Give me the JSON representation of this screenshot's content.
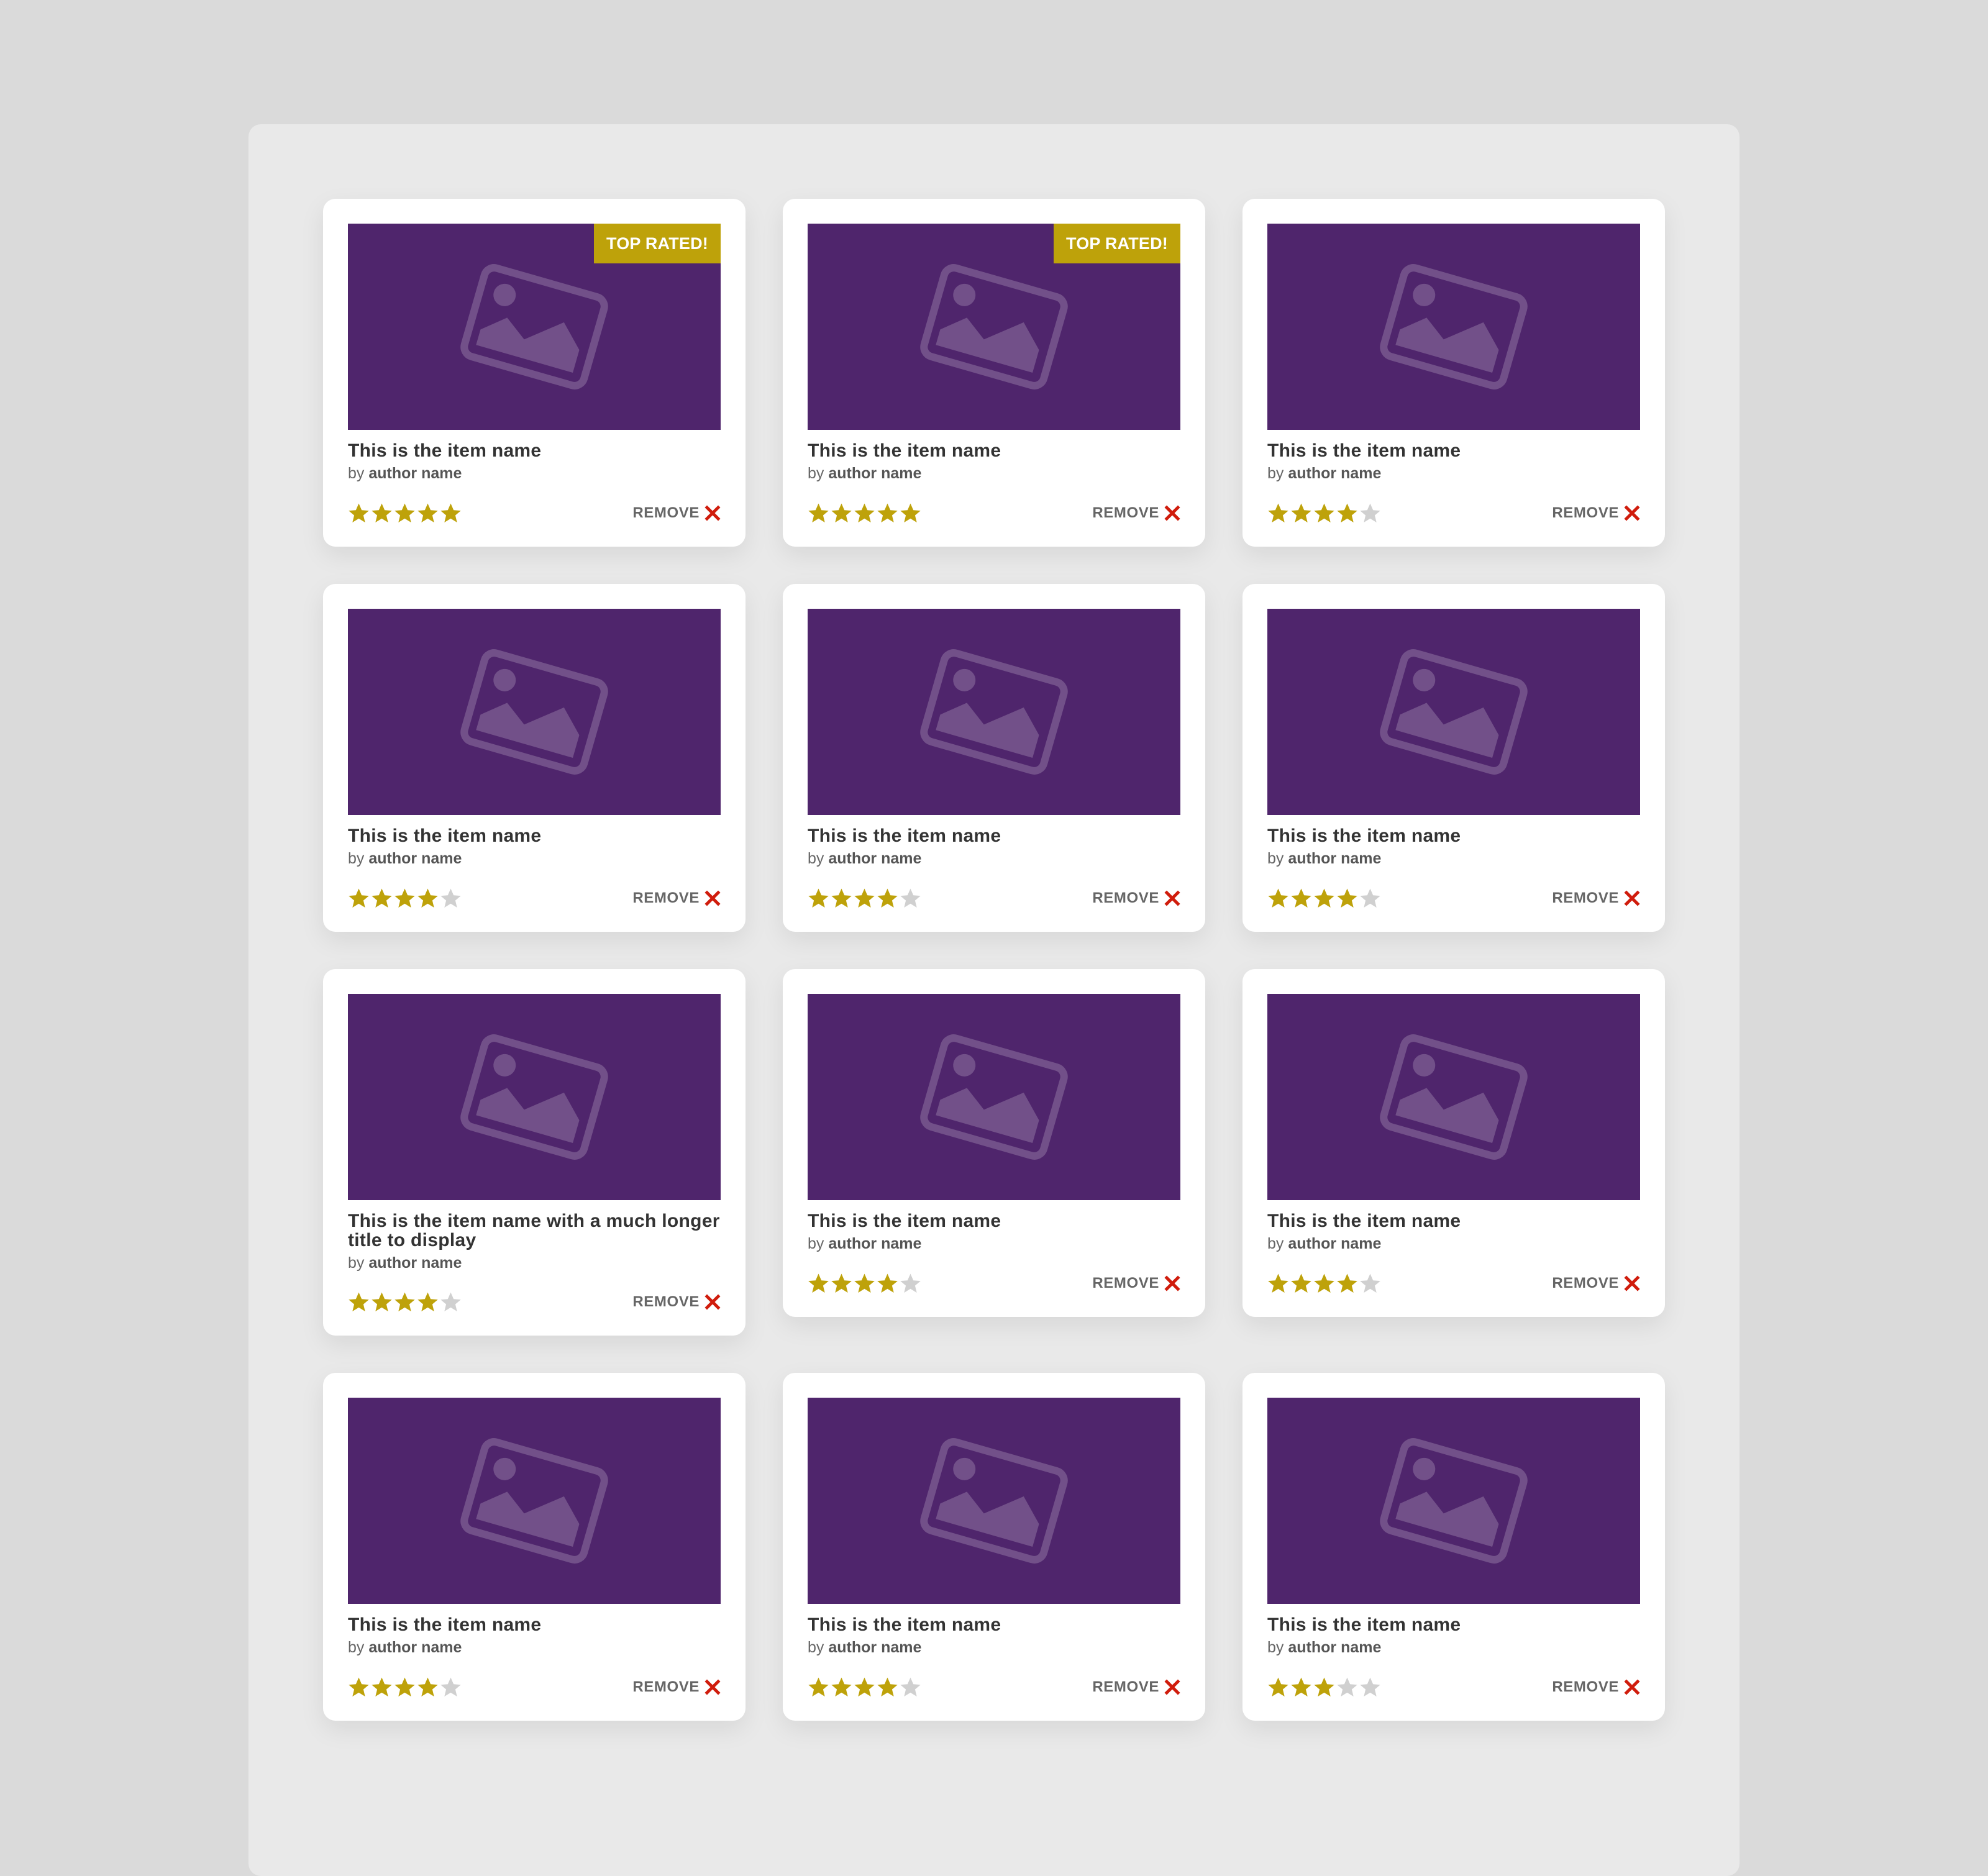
{
  "colors": {
    "page_background": "#dadada",
    "panel_background": "#e9e9e9",
    "image_placeholder": "#4f256c",
    "badge": "#bea20a",
    "star_filled": "#bea20a",
    "star_empty": "#d0d0d0",
    "remove_x": "#d01c0c"
  },
  "labels": {
    "remove": "REMOVE",
    "by": "by"
  },
  "items": [
    {
      "title": "This is the item name",
      "author": "author name",
      "rating": 5,
      "max_rating": 5,
      "badge": "TOP RATED!",
      "icon": "image-placeholder-icon"
    },
    {
      "title": "This is the item name",
      "author": "author name",
      "rating": 5,
      "max_rating": 5,
      "badge": "TOP RATED!",
      "icon": "image-placeholder-icon"
    },
    {
      "title": "This is the item name",
      "author": "author name",
      "rating": 4,
      "max_rating": 5,
      "badge": "",
      "icon": "image-placeholder-icon"
    },
    {
      "title": "This is the item name",
      "author": "author name",
      "rating": 4,
      "max_rating": 5,
      "badge": "",
      "icon": "image-placeholder-icon"
    },
    {
      "title": "This is the item name",
      "author": "author name",
      "rating": 4,
      "max_rating": 5,
      "badge": "",
      "icon": "image-placeholder-icon"
    },
    {
      "title": "This is the item name",
      "author": "author name",
      "rating": 4,
      "max_rating": 5,
      "badge": "",
      "icon": "image-placeholder-icon"
    },
    {
      "title": "This is the item name with a much longer title to display",
      "author": "author name",
      "rating": 4,
      "max_rating": 5,
      "badge": "",
      "icon": "image-placeholder-icon"
    },
    {
      "title": "This is the item name",
      "author": "author name",
      "rating": 4,
      "max_rating": 5,
      "badge": "",
      "icon": "image-placeholder-icon"
    },
    {
      "title": "This is the item name",
      "author": "author name",
      "rating": 4,
      "max_rating": 5,
      "badge": "",
      "icon": "image-placeholder-icon"
    },
    {
      "title": "This is the item name",
      "author": "author name",
      "rating": 4,
      "max_rating": 5,
      "badge": "",
      "icon": "image-placeholder-icon"
    },
    {
      "title": "This is the item name",
      "author": "author name",
      "rating": 4,
      "max_rating": 5,
      "badge": "",
      "icon": "image-placeholder-icon"
    },
    {
      "title": "This is the item name",
      "author": "author name",
      "rating": 3,
      "max_rating": 5,
      "badge": "",
      "icon": "image-placeholder-icon"
    }
  ]
}
